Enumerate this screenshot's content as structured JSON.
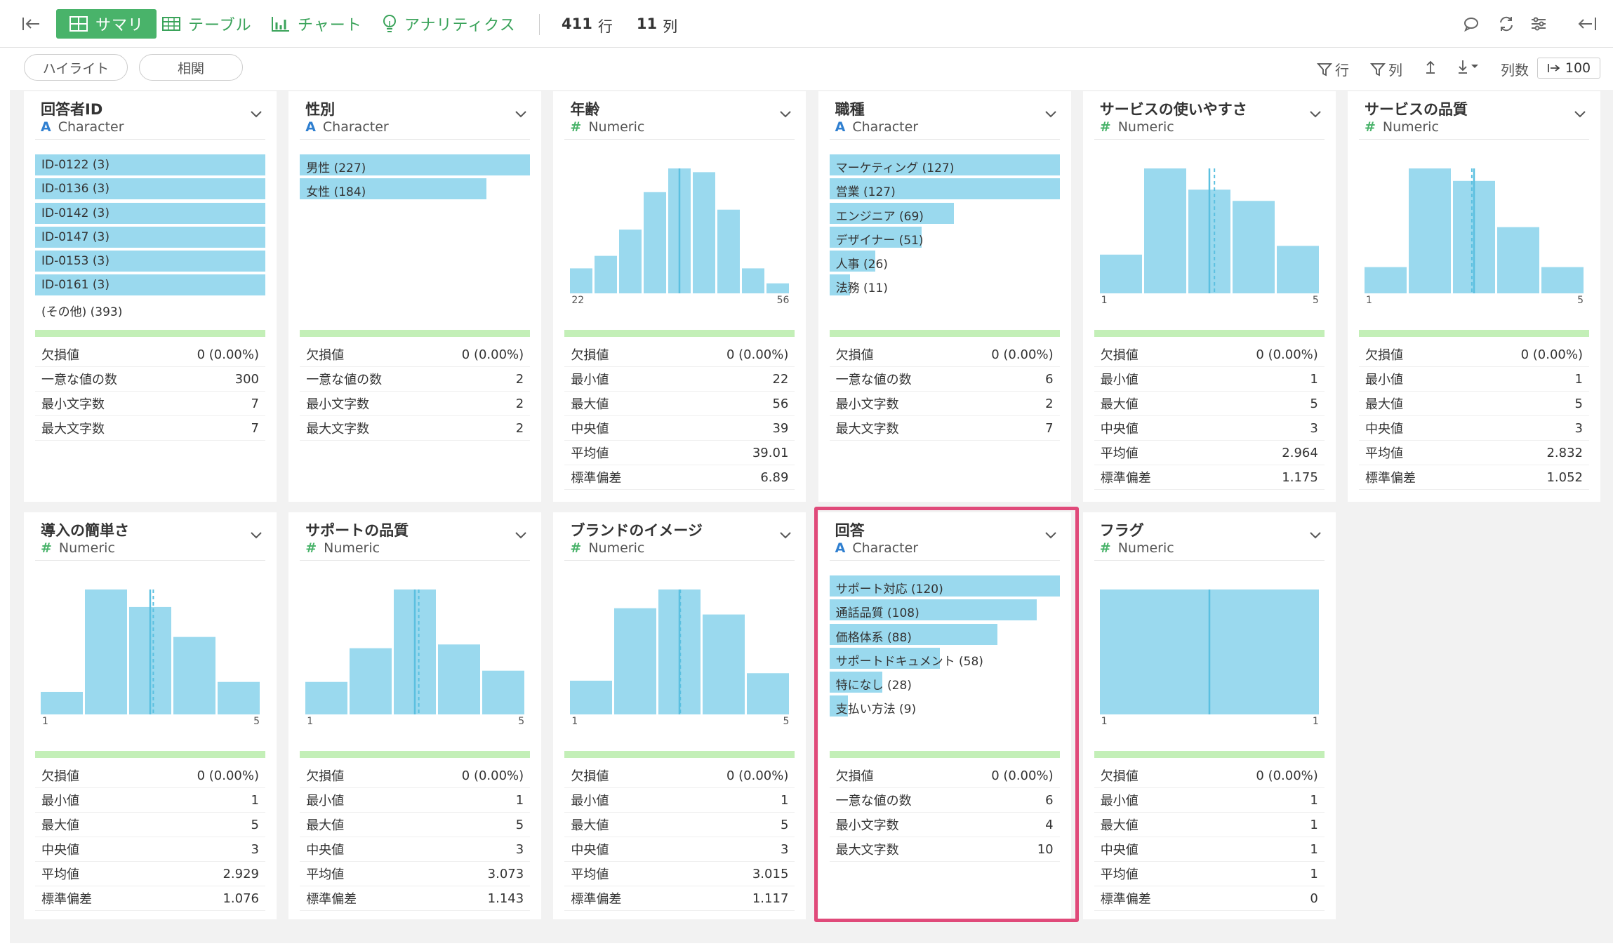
{
  "toolbar": {
    "tabs": [
      {
        "label": "サマリ",
        "icon": "summary-grid-icon"
      },
      {
        "label": "テーブル",
        "icon": "table-icon"
      },
      {
        "label": "チャート",
        "icon": "chart-icon"
      },
      {
        "label": "アナリティクス",
        "icon": "bulb-icon"
      }
    ],
    "rows_count": "411",
    "rows_unit": "行",
    "cols_count": "11",
    "cols_unit": "列"
  },
  "subbar": {
    "highlight_label": "ハイライト",
    "correlation_label": "相関",
    "filter_rows_label": "行",
    "filter_cols_label": "列",
    "column_count_label": "列数",
    "column_count_value": "100"
  },
  "colors": {
    "accent": "#49b36a",
    "bar": "#9ad9ee",
    "median": "#5bc0e0",
    "highlight": "#e04a7a",
    "quality": "#c3efb7"
  },
  "cards": [
    {
      "name": "回答者ID",
      "type_icon": "A",
      "type": "Character",
      "categories": [
        {
          "label": "ID-0122 (3)",
          "frac": 1.0
        },
        {
          "label": "ID-0136 (3)",
          "frac": 1.0
        },
        {
          "label": "ID-0142 (3)",
          "frac": 1.0
        },
        {
          "label": "ID-0147 (3)",
          "frac": 1.0
        },
        {
          "label": "ID-0153 (3)",
          "frac": 1.0
        },
        {
          "label": "ID-0161 (3)",
          "frac": 1.0
        }
      ],
      "other": "(その他) (393)",
      "stats": [
        {
          "k": "欠損値",
          "v": "0 (0.00%)"
        },
        {
          "k": "一意な値の数",
          "v": "300"
        },
        {
          "k": "最小文字数",
          "v": "7"
        },
        {
          "k": "最大文字数",
          "v": "7"
        }
      ]
    },
    {
      "name": "性別",
      "type_icon": "A",
      "type": "Character",
      "categories": [
        {
          "label": "男性 (227)",
          "frac": 1.0
        },
        {
          "label": "女性 (184)",
          "frac": 0.81
        }
      ],
      "stats": [
        {
          "k": "欠損値",
          "v": "0 (0.00%)"
        },
        {
          "k": "一意な値の数",
          "v": "2"
        },
        {
          "k": "最小文字数",
          "v": "2"
        },
        {
          "k": "最大文字数",
          "v": "2"
        }
      ]
    },
    {
      "name": "年齢",
      "type_icon": "#",
      "type": "Numeric",
      "hist": [
        0.2,
        0.3,
        0.51,
        0.81,
        1.0,
        0.97,
        0.67,
        0.2,
        0.08
      ],
      "median_frac": 0.5,
      "mean_frac": null,
      "axis_min": "22",
      "axis_max": "56",
      "stats": [
        {
          "k": "欠損値",
          "v": "0 (0.00%)"
        },
        {
          "k": "最小値",
          "v": "22"
        },
        {
          "k": "最大値",
          "v": "56"
        },
        {
          "k": "中央値",
          "v": "39"
        },
        {
          "k": "平均値",
          "v": "39.01"
        },
        {
          "k": "標準偏差",
          "v": "6.89"
        }
      ]
    },
    {
      "name": "職種",
      "type_icon": "A",
      "type": "Character",
      "categories": [
        {
          "label": "マーケティング (127)",
          "frac": 1.0
        },
        {
          "label": "営業 (127)",
          "frac": 1.0
        },
        {
          "label": "エンジニア (69)",
          "frac": 0.54
        },
        {
          "label": "デザイナー (51)",
          "frac": 0.4
        },
        {
          "label": "人事 (26)",
          "frac": 0.2
        },
        {
          "label": "法務 (11)",
          "frac": 0.09
        }
      ],
      "stats": [
        {
          "k": "欠損値",
          "v": "0 (0.00%)"
        },
        {
          "k": "一意な値の数",
          "v": "6"
        },
        {
          "k": "最小文字数",
          "v": "2"
        },
        {
          "k": "最大文字数",
          "v": "7"
        }
      ]
    },
    {
      "name": "サービスの使いやすさ",
      "type_icon": "#",
      "type": "Numeric",
      "hist": [
        0.31,
        1.0,
        0.83,
        0.74,
        0.38
      ],
      "median_frac": 0.5,
      "mean_frac": 0.491,
      "axis_min": "1",
      "axis_max": "5",
      "stats": [
        {
          "k": "欠損値",
          "v": "0 (0.00%)"
        },
        {
          "k": "最小値",
          "v": "1"
        },
        {
          "k": "最大値",
          "v": "5"
        },
        {
          "k": "中央値",
          "v": "3"
        },
        {
          "k": "平均値",
          "v": "2.964"
        },
        {
          "k": "標準偏差",
          "v": "1.175"
        }
      ]
    },
    {
      "name": "サービスの品質",
      "type_icon": "#",
      "type": "Numeric",
      "hist": [
        0.21,
        1.0,
        0.9,
        0.53,
        0.21
      ],
      "median_frac": 0.5,
      "mean_frac": 0.458,
      "axis_min": "1",
      "axis_max": "5",
      "stats": [
        {
          "k": "欠損値",
          "v": "0 (0.00%)"
        },
        {
          "k": "最小値",
          "v": "1"
        },
        {
          "k": "最大値",
          "v": "5"
        },
        {
          "k": "中央値",
          "v": "3"
        },
        {
          "k": "平均値",
          "v": "2.832"
        },
        {
          "k": "標準偏差",
          "v": "1.052"
        }
      ]
    },
    {
      "name": "導入の簡単さ",
      "type_icon": "#",
      "type": "Numeric",
      "hist": [
        0.18,
        1.0,
        0.86,
        0.62,
        0.26
      ],
      "median_frac": 0.5,
      "mean_frac": 0.482,
      "axis_min": "1",
      "axis_max": "5",
      "stats": [
        {
          "k": "欠損値",
          "v": "0 (0.00%)"
        },
        {
          "k": "最小値",
          "v": "1"
        },
        {
          "k": "最大値",
          "v": "5"
        },
        {
          "k": "中央値",
          "v": "3"
        },
        {
          "k": "平均値",
          "v": "2.929"
        },
        {
          "k": "標準偏差",
          "v": "1.076"
        }
      ]
    },
    {
      "name": "サポートの品質",
      "type_icon": "#",
      "type": "Numeric",
      "hist": [
        0.26,
        0.53,
        1.0,
        0.56,
        0.35
      ],
      "median_frac": 0.5,
      "mean_frac": 0.518,
      "axis_min": "1",
      "axis_max": "5",
      "stats": [
        {
          "k": "欠損値",
          "v": "0 (0.00%)"
        },
        {
          "k": "最小値",
          "v": "1"
        },
        {
          "k": "最大値",
          "v": "5"
        },
        {
          "k": "中央値",
          "v": "3"
        },
        {
          "k": "平均値",
          "v": "3.073"
        },
        {
          "k": "標準偏差",
          "v": "1.143"
        }
      ]
    },
    {
      "name": "ブランドのイメージ",
      "type_icon": "#",
      "type": "Numeric",
      "hist": [
        0.27,
        0.85,
        1.0,
        0.8,
        0.33
      ],
      "median_frac": 0.5,
      "mean_frac": 0.504,
      "axis_min": "1",
      "axis_max": "5",
      "stats": [
        {
          "k": "欠損値",
          "v": "0 (0.00%)"
        },
        {
          "k": "最小値",
          "v": "1"
        },
        {
          "k": "最大値",
          "v": "5"
        },
        {
          "k": "中央値",
          "v": "3"
        },
        {
          "k": "平均値",
          "v": "3.015"
        },
        {
          "k": "標準偏差",
          "v": "1.117"
        }
      ]
    },
    {
      "name": "回答",
      "type_icon": "A",
      "type": "Character",
      "categories": [
        {
          "label": "サポート対応 (120)",
          "frac": 1.0
        },
        {
          "label": "通話品質 (108)",
          "frac": 0.9
        },
        {
          "label": "価格体系 (88)",
          "frac": 0.73
        },
        {
          "label": "サポートドキュメント (58)",
          "frac": 0.48
        },
        {
          "label": "特になし (28)",
          "frac": 0.23
        },
        {
          "label": "支払い方法 (9)",
          "frac": 0.08
        }
      ],
      "stats": [
        {
          "k": "欠損値",
          "v": "0 (0.00%)"
        },
        {
          "k": "一意な値の数",
          "v": "6"
        },
        {
          "k": "最小文字数",
          "v": "4"
        },
        {
          "k": "最大文字数",
          "v": "10"
        }
      ]
    },
    {
      "name": "フラグ",
      "type_icon": "#",
      "type": "Numeric",
      "hist": [
        1.0
      ],
      "median_frac": 0.5,
      "mean_frac": null,
      "axis_min": "1",
      "axis_max": "1",
      "stats": [
        {
          "k": "欠損値",
          "v": "0 (0.00%)"
        },
        {
          "k": "最小値",
          "v": "1"
        },
        {
          "k": "最大値",
          "v": "1"
        },
        {
          "k": "中央値",
          "v": "1"
        },
        {
          "k": "平均値",
          "v": "1"
        },
        {
          "k": "標準偏差",
          "v": "0"
        }
      ]
    }
  ]
}
